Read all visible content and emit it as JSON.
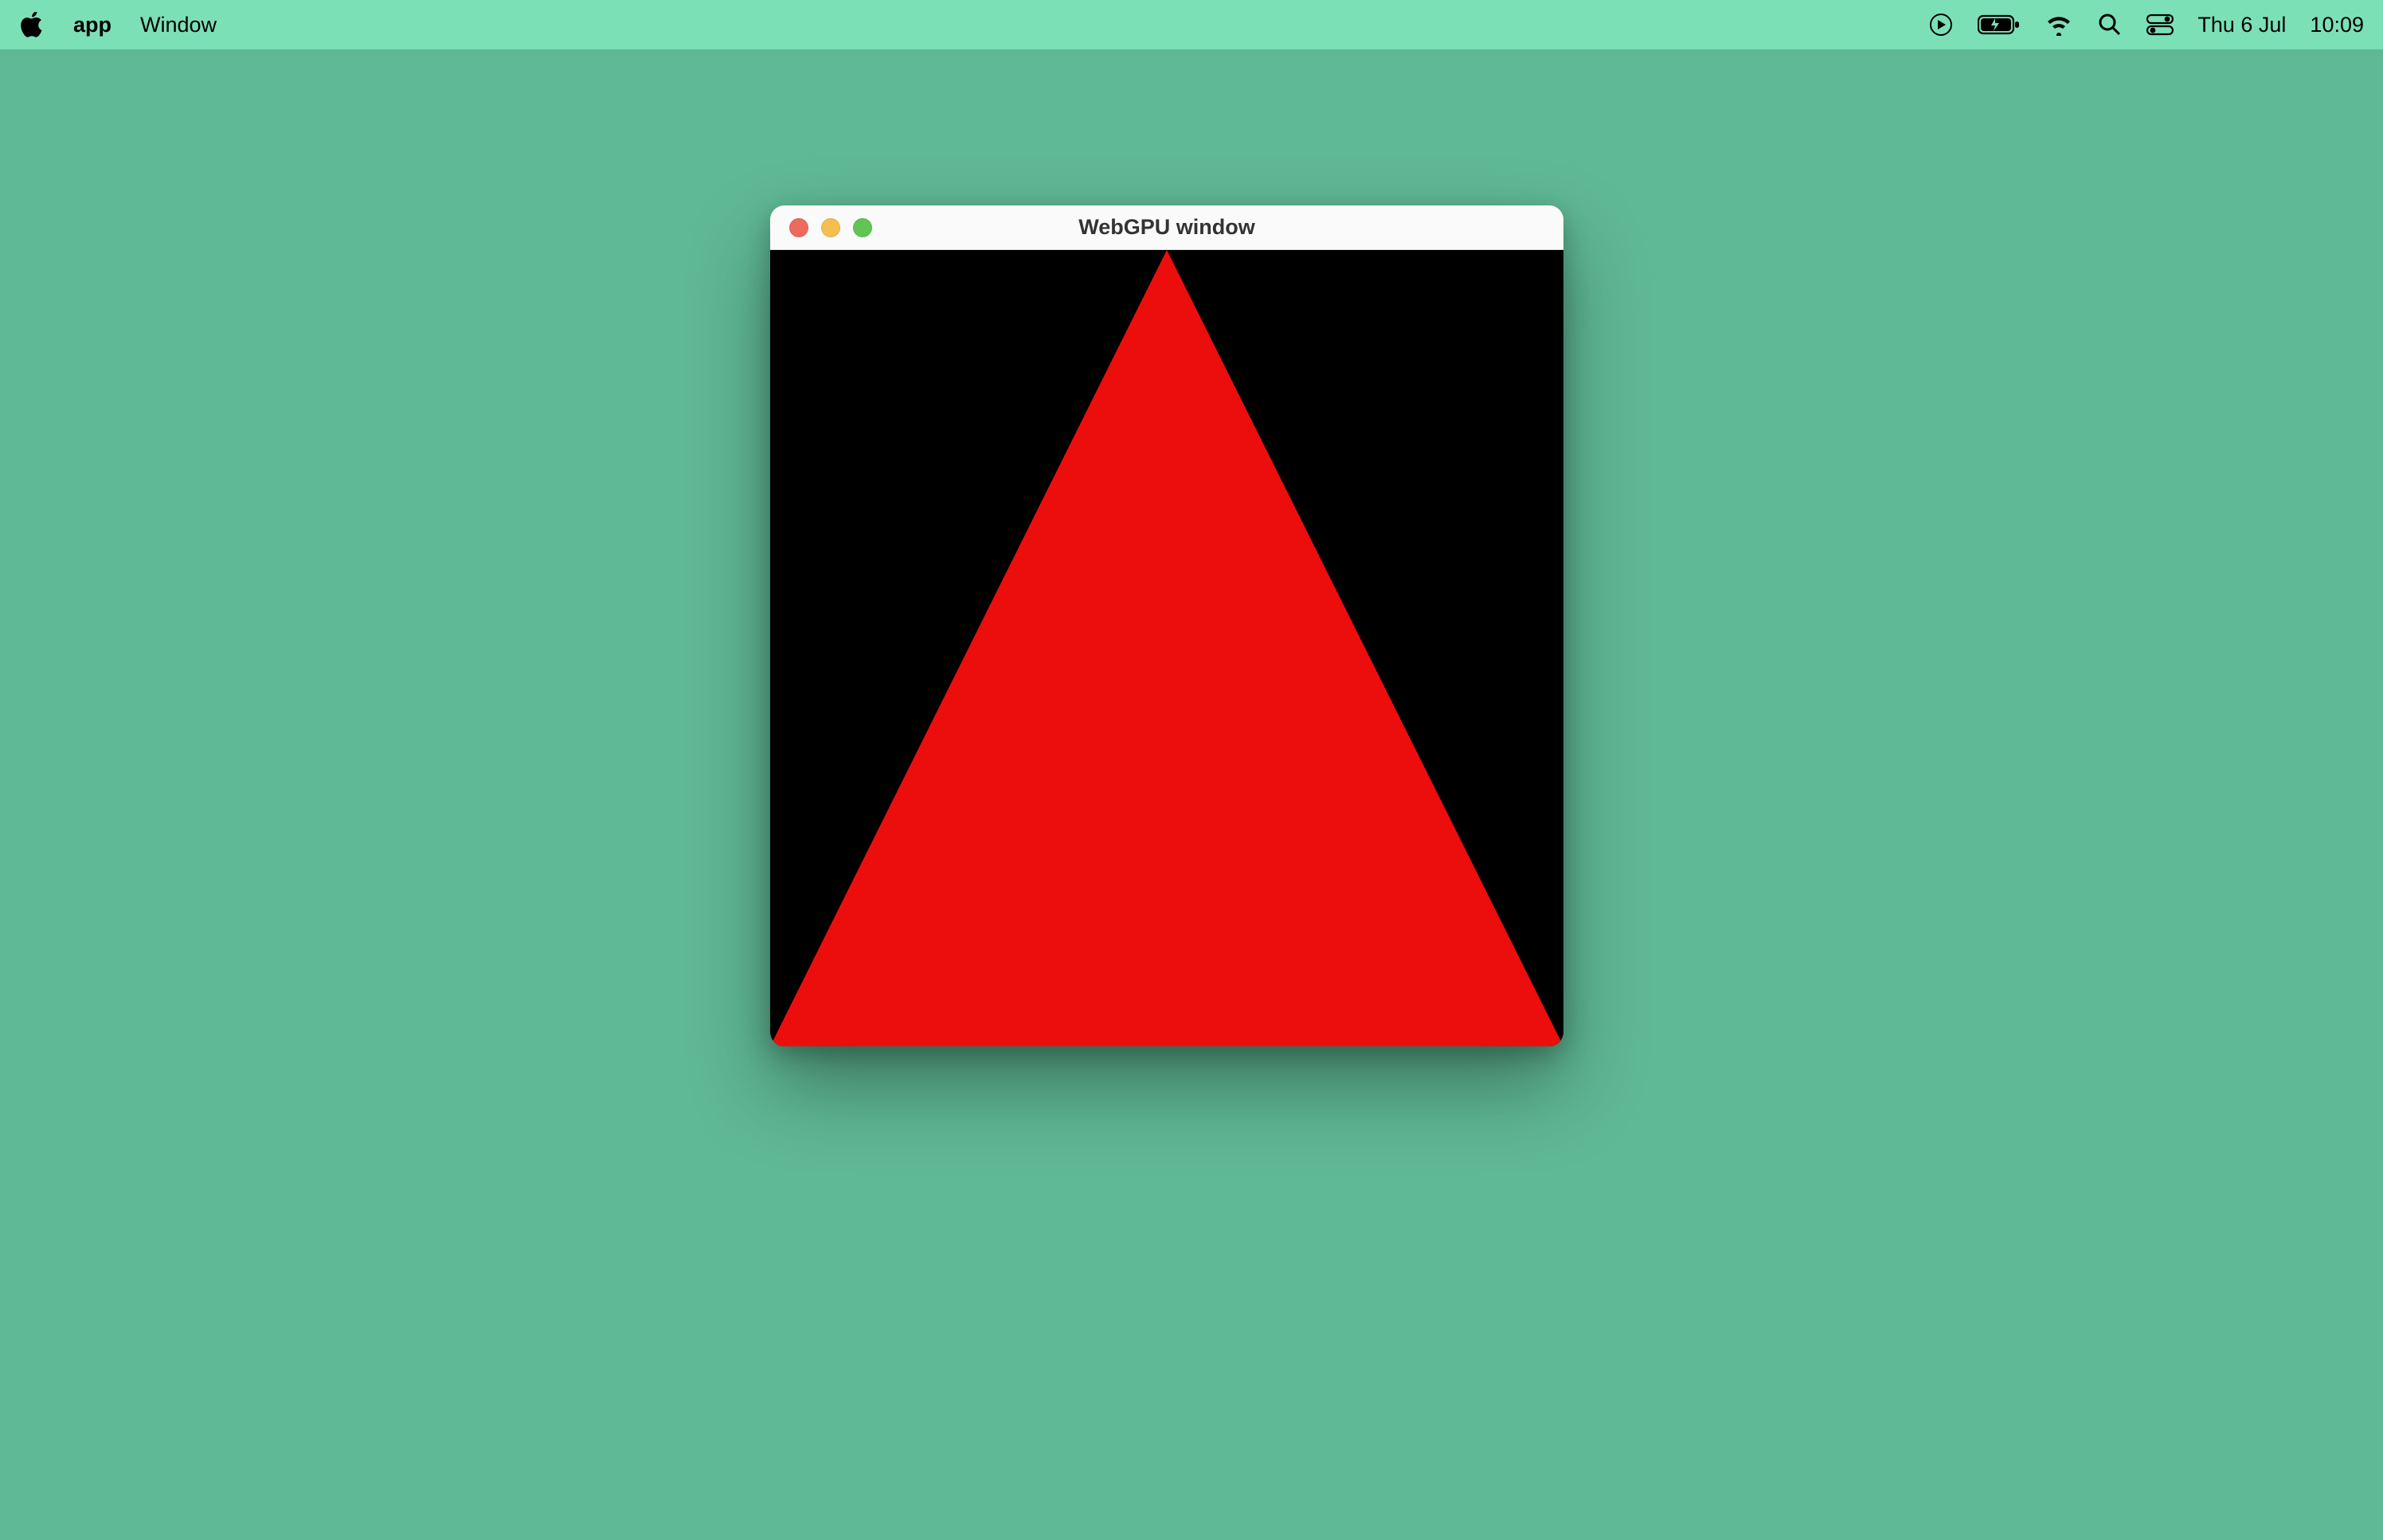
{
  "menubar": {
    "app_name": "app",
    "menu_items": [
      "Window"
    ],
    "date": "Thu 6 Jul",
    "time": "10:09"
  },
  "window": {
    "title": "WebGPU window",
    "content": {
      "background_color": "#000000",
      "shape": "triangle",
      "shape_color": "#EC0E0D"
    }
  },
  "desktop": {
    "background_color": "#5FB896"
  }
}
